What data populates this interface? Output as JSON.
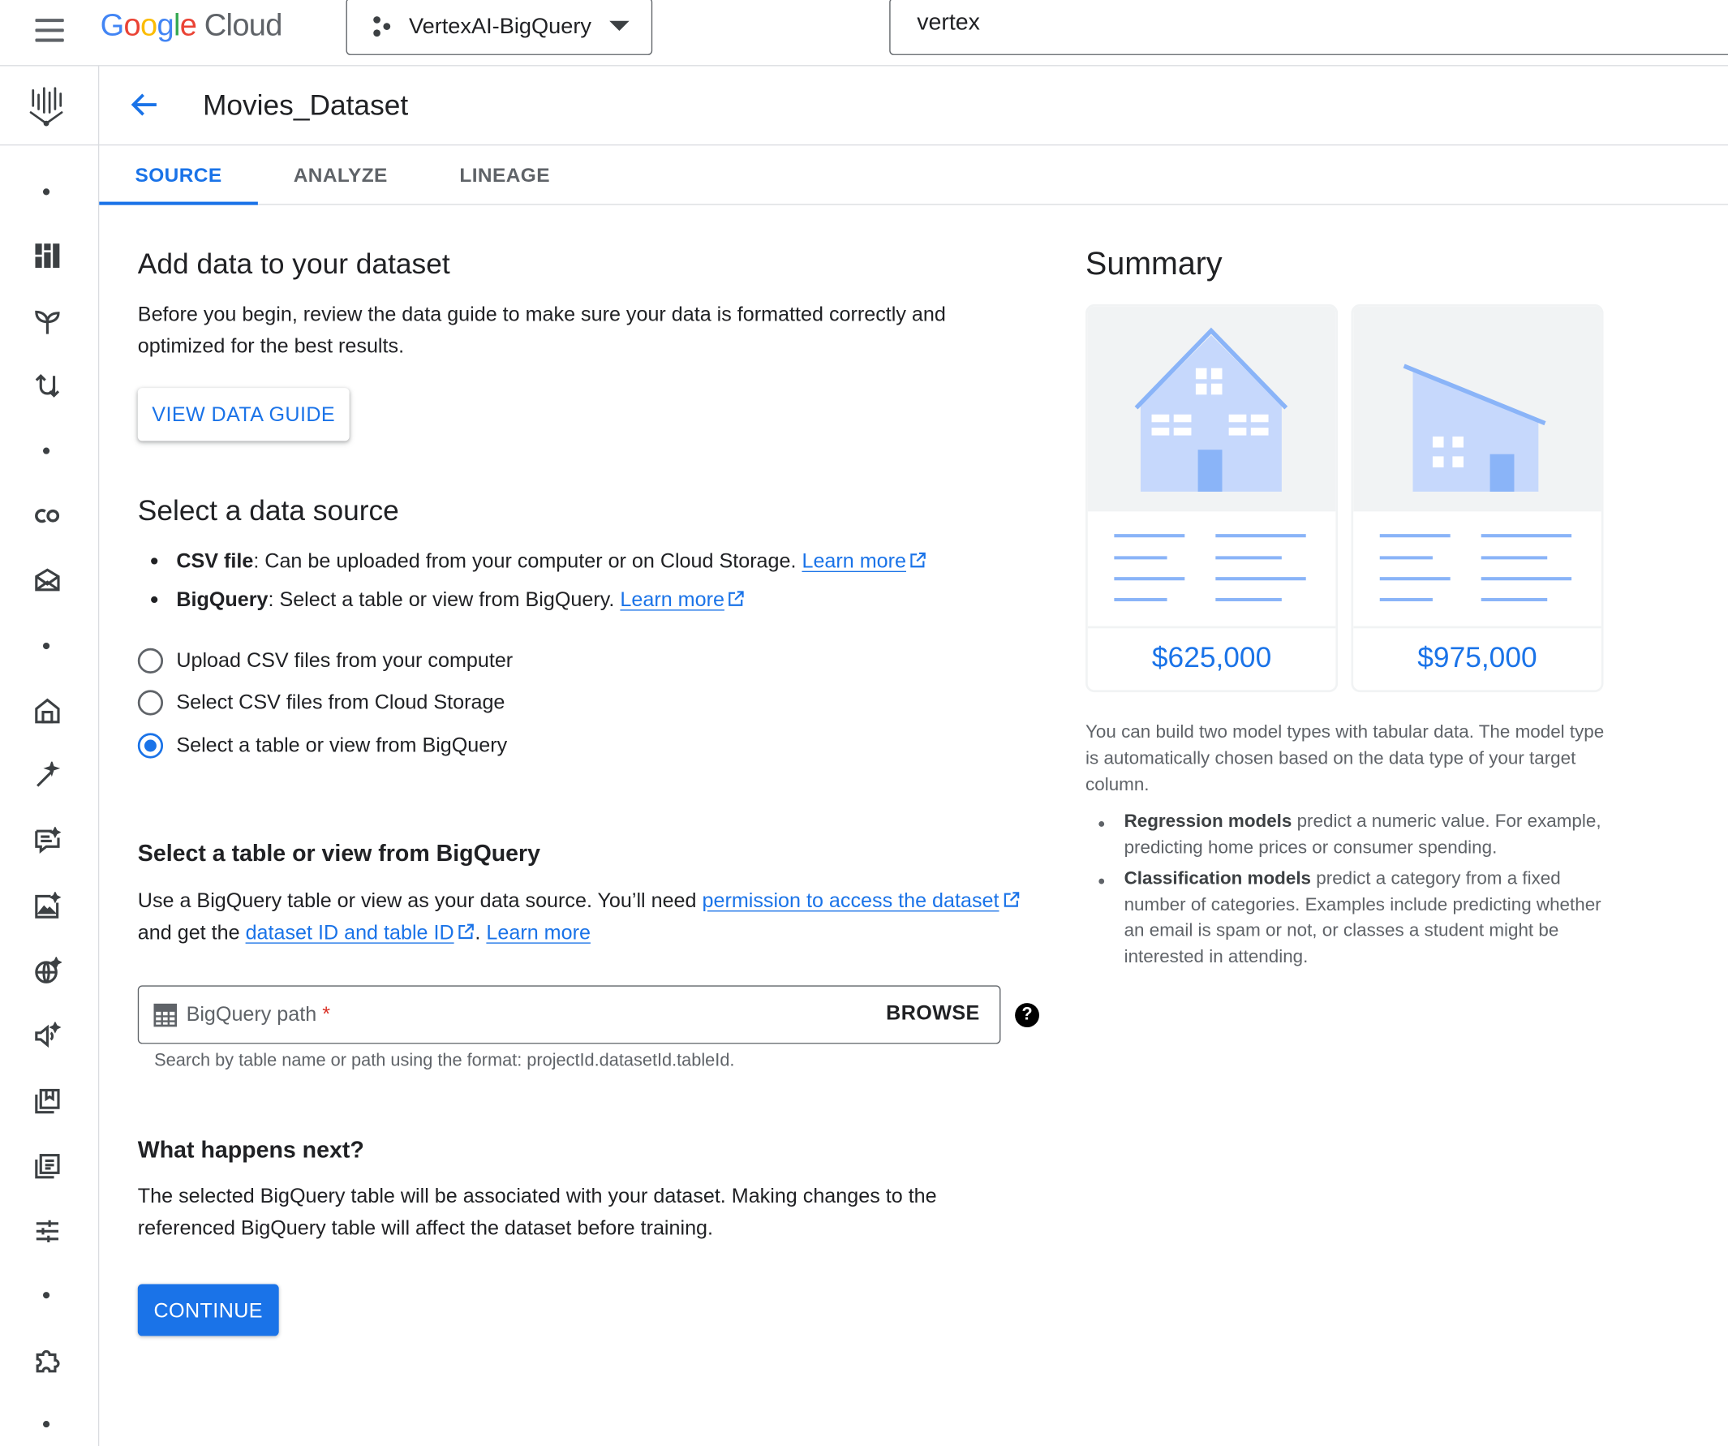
{
  "header": {
    "logo_google": [
      "G",
      "o",
      "o",
      "g",
      "l",
      "e"
    ],
    "logo_cloud": "Cloud",
    "project_name": "VertexAI-BigQuery",
    "search_value": "vertex"
  },
  "page": {
    "title": "Movies_Dataset",
    "tabs": [
      {
        "label": "SOURCE",
        "active": true
      },
      {
        "label": "ANALYZE",
        "active": false
      },
      {
        "label": "LINEAGE",
        "active": false
      }
    ]
  },
  "add_data": {
    "heading": "Add data to your dataset",
    "intro_line1": "Before you begin, review the data guide to make sure your data is formatted correctly and",
    "intro_line2": "optimized for the best results.",
    "guide_button": "VIEW DATA GUIDE"
  },
  "data_source": {
    "heading": "Select a data source",
    "bullets": [
      {
        "bold": "CSV file",
        "text": ": Can be uploaded from your computer or on Cloud Storage. ",
        "link": "Learn more"
      },
      {
        "bold": "BigQuery",
        "text": ": Select a table or view from BigQuery. ",
        "link": "Learn more"
      }
    ],
    "options": [
      {
        "label": "Upload CSV files from your computer",
        "selected": false
      },
      {
        "label": "Select CSV files from Cloud Storage",
        "selected": false
      },
      {
        "label": "Select a table or view from BigQuery",
        "selected": true
      }
    ]
  },
  "bigquery": {
    "heading": "Select a table or view from BigQuery",
    "desc_part1": "Use a BigQuery table or view as your data source. You’ll need ",
    "desc_link1": "permission to access the dataset",
    "desc_part2": "and get the ",
    "desc_link2": "dataset ID and table ID",
    "desc_part3": ". ",
    "desc_link3": "Learn more",
    "field_placeholder": "BigQuery path",
    "field_required": "*",
    "browse_label": "BROWSE",
    "help_glyph": "?",
    "hint": "Search by table name or path using the format: projectId.datasetId.tableId."
  },
  "next": {
    "heading": "What happens next?",
    "line1": "The selected BigQuery table will be associated with your dataset. Making changes to the",
    "line2": "referenced BigQuery table will affect the dataset before training.",
    "continue_label": "CONTINUE"
  },
  "summary": {
    "title": "Summary",
    "cards": [
      {
        "price": "$625,000",
        "icon": "house-illustration"
      },
      {
        "price": "$975,000",
        "icon": "building-illustration"
      }
    ],
    "description": "You can build two model types with tabular data. The model type is automatically chosen based on the data type of your target column.",
    "items": [
      {
        "bold": "Regression models",
        "text": " predict a numeric value. For example, predicting home prices or consumer spending."
      },
      {
        "bold": "Classification models",
        "text": " predict a category from a fixed number of categories. Examples include predicting whether an email is spam or not, or classes a student might be interested in attending."
      }
    ]
  },
  "colors": {
    "accent": "#1a73e8",
    "illustration": "#c6d8fc",
    "illustration_dark": "#8ab4f8"
  }
}
